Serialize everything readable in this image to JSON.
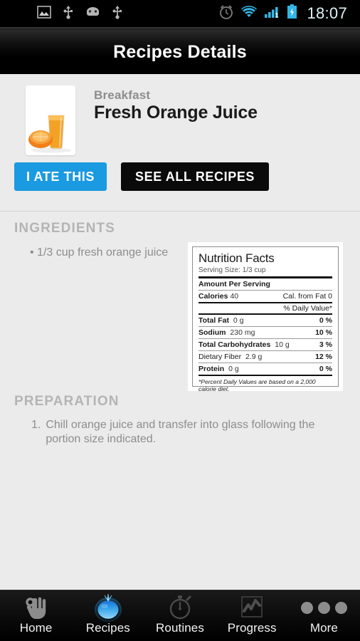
{
  "status_bar": {
    "time": "18:07",
    "left_icons": [
      "image-icon",
      "usb-icon",
      "android-icon",
      "usb-icon"
    ],
    "right_icons": [
      "alarm-icon",
      "wifi-icon",
      "signal-icon",
      "battery-charging-icon"
    ],
    "accent_color": "#33b5e5"
  },
  "title_bar": {
    "title": "Recipes Details"
  },
  "recipe": {
    "meal_type": "Breakfast",
    "name": "Fresh Orange Juice",
    "thumbnail": "orange-juice-glass-image",
    "ate_button": "I ATE THIS",
    "see_all_button": "SEE ALL RECIPES",
    "primary_color": "#1a9ae0",
    "dark_color": "#0a0a0a"
  },
  "ingredients": {
    "heading": "INGREDIENTS",
    "items": [
      "1/3 cup fresh orange juice"
    ]
  },
  "preparation": {
    "heading": "PREPARATION",
    "steps": [
      {
        "number": "1.",
        "text": "Chill orange juice and transfer into glass following the portion size indicated."
      }
    ]
  },
  "nutrition": {
    "title": "Nutrition Facts",
    "serving_size": "Serving Size: 1/3 cup",
    "amount_per_serving": "Amount Per Serving",
    "calories_label": "Calories",
    "calories_value": "40",
    "cal_from_fat": "Cal. from Fat 0",
    "daily_value_header": "% Daily Value*",
    "rows": [
      {
        "label": "Total Fat",
        "amount": "0 g",
        "dv": "0 %",
        "bold": true
      },
      {
        "label": "Sodium",
        "amount": "230 mg",
        "dv": "10 %",
        "bold": true
      },
      {
        "label": "Total Carbohydrates",
        "amount": "10 g",
        "dv": "3 %",
        "bold": true
      },
      {
        "label": "Dietary Fiber",
        "amount": "2.9 g",
        "dv": "12 %",
        "bold": false
      },
      {
        "label": "Protein",
        "amount": "0 g",
        "dv": "0 %",
        "bold": true
      }
    ],
    "footnote": "*Percent Daily Values are based on a 2,000 calorie diet."
  },
  "tabbar": {
    "items": [
      {
        "label": "Home",
        "icon": "ok-hand-icon",
        "active": false
      },
      {
        "label": "Recipes",
        "icon": "tomato-icon",
        "active": true
      },
      {
        "label": "Routines",
        "icon": "stopwatch-icon",
        "active": false
      },
      {
        "label": "Progress",
        "icon": "chart-icon",
        "active": false
      },
      {
        "label": "More",
        "icon": "ellipsis-icon",
        "active": false
      }
    ]
  }
}
